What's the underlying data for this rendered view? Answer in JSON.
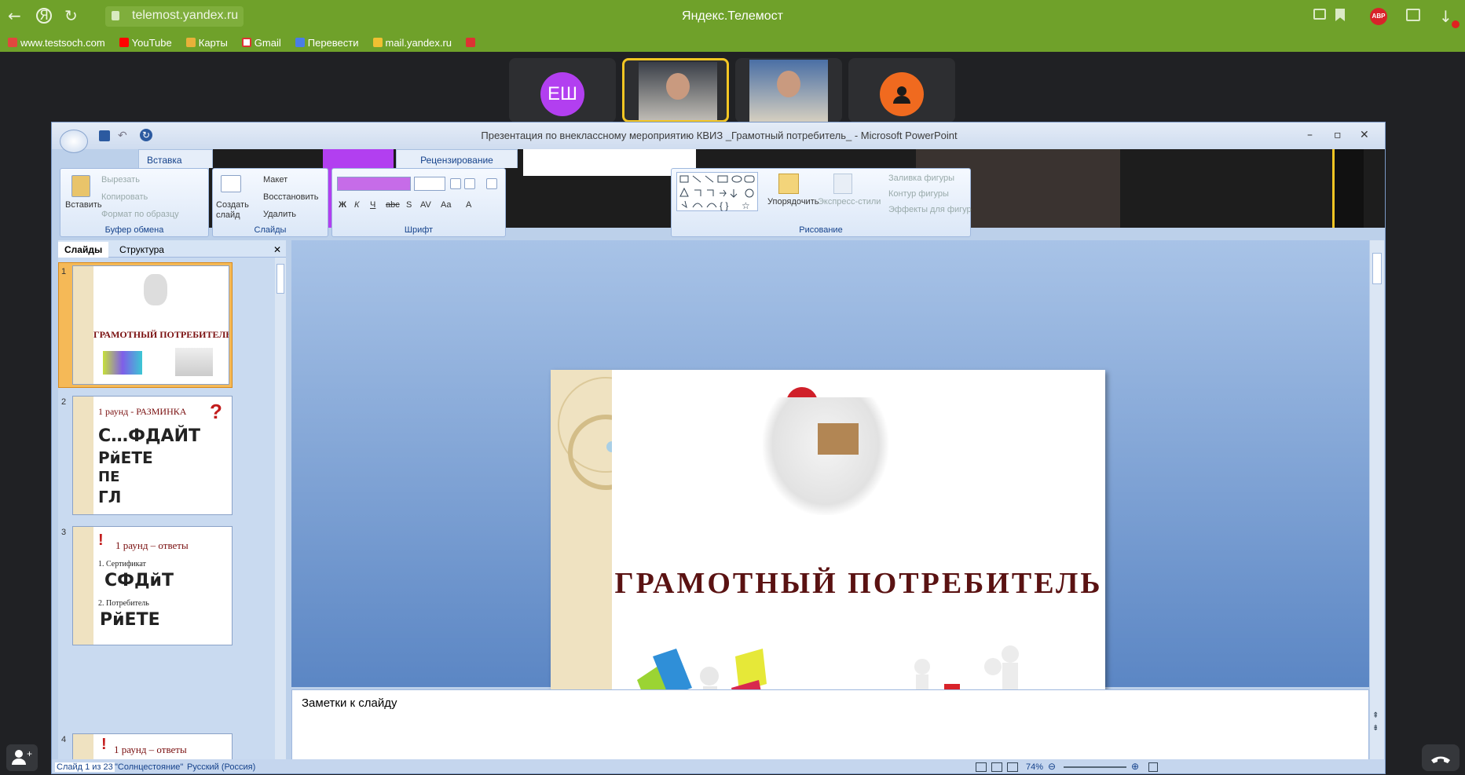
{
  "browser": {
    "url": "telemost.yandex.ru",
    "window_title": "Яндекс.Телемост",
    "adblock_label": "ABP",
    "bookmarks": [
      {
        "label": "www.testsoch.com",
        "color": "#e0483e"
      },
      {
        "label": "YouTube",
        "color": "#ff0000"
      },
      {
        "label": "Карты",
        "color": "#e8b13a"
      },
      {
        "label": "Gmail",
        "color": "#ffffff"
      },
      {
        "label": "Перевести",
        "color": "#4a7de6"
      },
      {
        "label": "mail.yandex.ru",
        "color": "#f0c032"
      }
    ]
  },
  "telemost": {
    "participants": [
      {
        "initials": "ЕШ",
        "color": "#b23ff0"
      },
      {
        "initials": "",
        "video": true,
        "active": true
      },
      {
        "initials": "",
        "video": true
      },
      {
        "initials": "",
        "color": "#f06a1f",
        "icon": "user-icon"
      }
    ]
  },
  "ppt": {
    "title": "Презентация по внеклассному мероприятию КВИЗ _Грамотный потребитель_ - Microsoft PowerPoint",
    "tabs": [
      "Вставка",
      "Рецензирование"
    ],
    "ribbon": {
      "clipboard": {
        "paste": "Вставить",
        "cut": "Вырезать",
        "copy": "Копировать",
        "format": "Формат по образцу",
        "label": "Буфер обмена"
      },
      "slides": {
        "new_slide": "Создать слайд",
        "layout": "Макет",
        "reset": "Восстановить",
        "delete": "Удалить",
        "label": "Слайды"
      },
      "font": {
        "label": "Шрифт"
      },
      "drawing": {
        "arrange": "Упорядочить",
        "quick_styles": "Экспресс-стили",
        "fill": "Заливка фигуры",
        "outline": "Контур фигуры",
        "effects": "Эффекты для фигур",
        "label": "Рисование"
      }
    },
    "pane_tabs": [
      "Слайды",
      "Структура"
    ],
    "thumbnails": [
      {
        "num": "1",
        "title": "ГРАМОТНЫЙ  ПОТРЕБИТЕЛЬ"
      },
      {
        "num": "2",
        "title": "1 раунд -  РАЗМИНКА",
        "lines": [
          "С…ФДАЙТ",
          "РйЕТЕ",
          "ПЕ",
          "ГЛ"
        ]
      },
      {
        "num": "3",
        "title": "1 раунд – ответы",
        "lines": [
          "1. Сертификат",
          "СФДйТ",
          "2. Потребитель",
          "РйЕТЕ"
        ]
      },
      {
        "num": "4",
        "title": "1 раунд – ответы"
      }
    ],
    "slide_title": "ГРАМОТНЫЙ   ПОТРЕБИТЕЛЬ",
    "notes_placeholder": "Заметки к слайду",
    "status": {
      "slide": "Слайд 1 из 23",
      "theme": "\"Солнцестояние\"",
      "language": "Русский (Россия)",
      "zoom": "74%"
    },
    "colors": {
      "chrome_green": "#6fa12a",
      "title_red": "#5a1212"
    }
  }
}
